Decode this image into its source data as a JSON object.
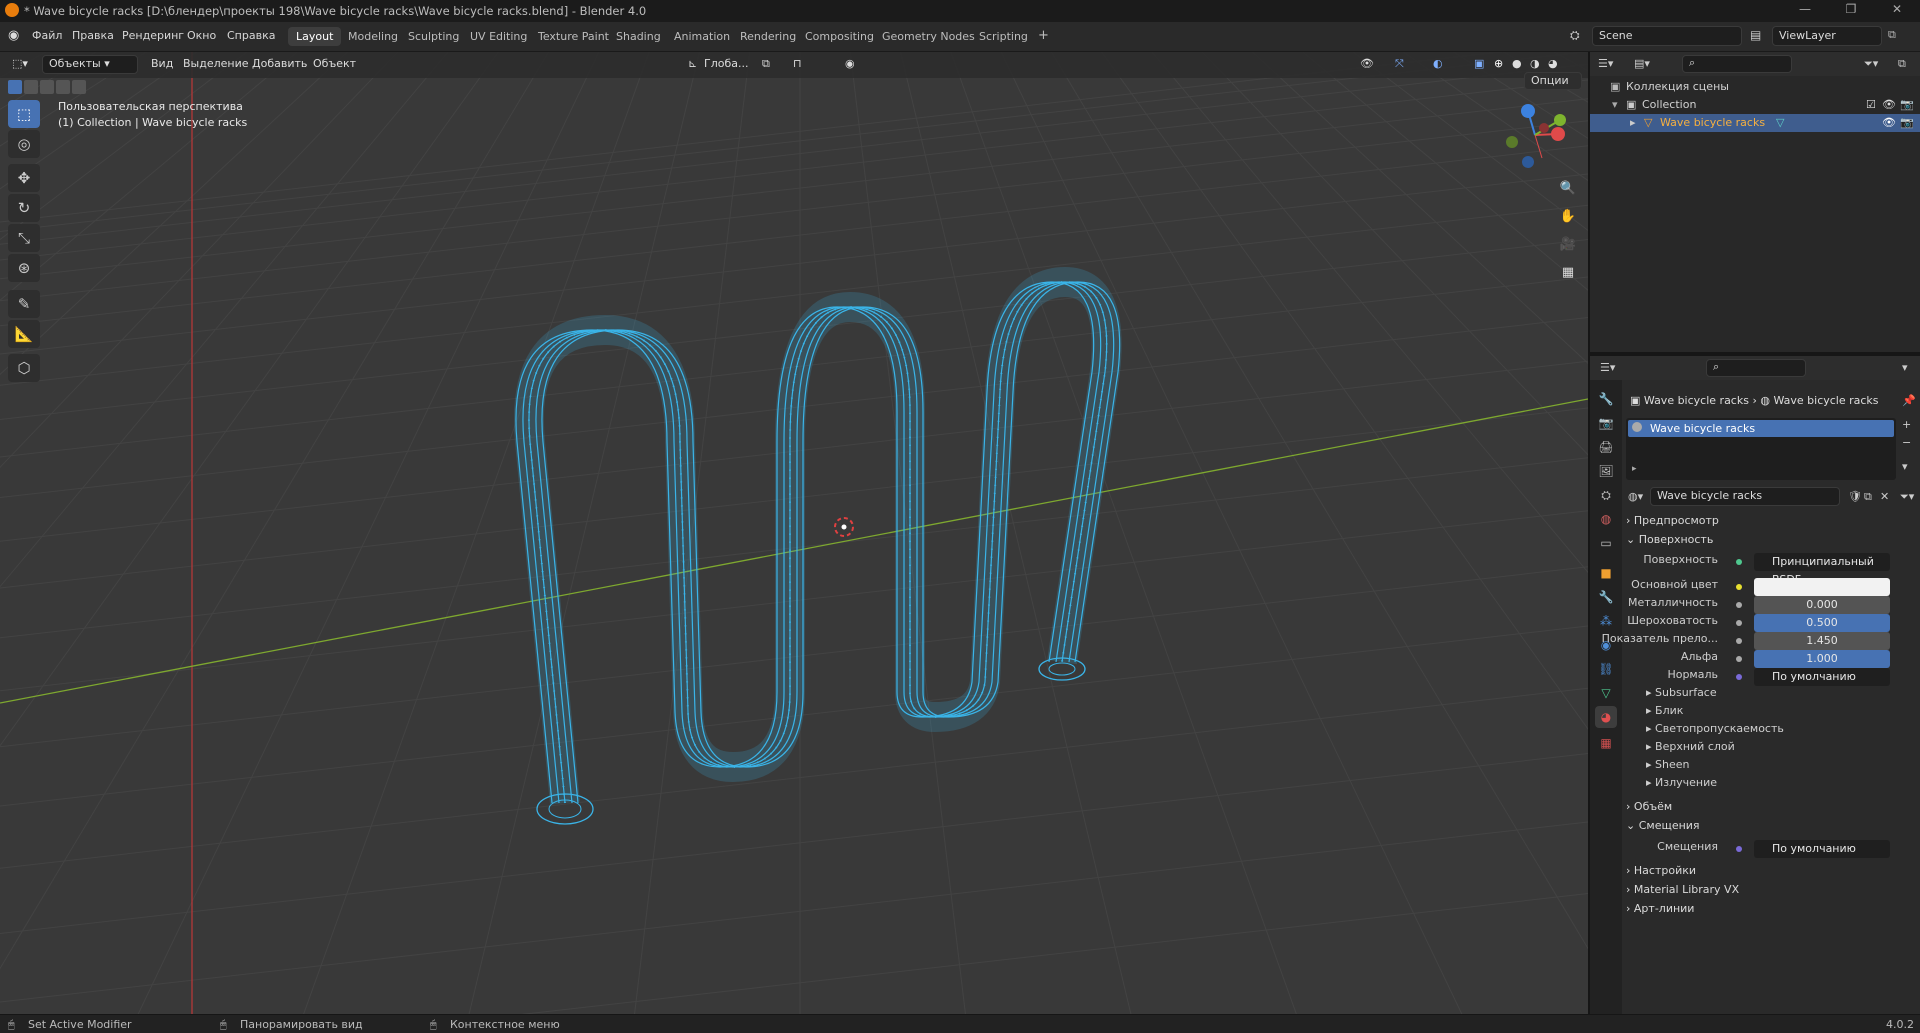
{
  "window": {
    "title": "* Wave bicycle racks [D:\\блендер\\проекты 198\\Wave bicycle racks\\Wave bicycle racks.blend] - Blender 4.0"
  },
  "menu": [
    "Файл",
    "Правка",
    "Рендеринг",
    "Окно",
    "Справка"
  ],
  "workspaces": [
    "Layout",
    "Modeling",
    "Sculpting",
    "UV Editing",
    "Texture Paint",
    "Shading",
    "Animation",
    "Rendering",
    "Compositing",
    "Geometry Nodes",
    "Scripting"
  ],
  "active_workspace": "Layout",
  "scene": {
    "name": "Scene",
    "view_layer": "ViewLayer"
  },
  "viewport": {
    "mode": "Объекты",
    "menu": [
      "Вид",
      "Выделение",
      "Добавить",
      "Объект"
    ],
    "transform_orientation": "Глоба...",
    "options": "Опции",
    "overlay_line1": "Пользовательская перспектива",
    "overlay_line2": "(1) Collection | Wave bicycle racks",
    "wire_color": "#3ab4e8",
    "grid_color": "#434343",
    "x_axis_color": "#c23a3a",
    "y_axis_color": "#7ea82f"
  },
  "outliner": {
    "root": "Коллекция сцены",
    "collection": "Collection",
    "object": "Wave bicycle racks"
  },
  "properties": {
    "breadcrumb_object": "Wave bicycle racks",
    "breadcrumb_material": "Wave bicycle racks",
    "slot": "Wave bicycle racks",
    "material_name": "Wave bicycle racks",
    "panel_preview": "Предпросмотр",
    "panel_surface": "Поверхность",
    "surface_label": "Поверхность",
    "surface_value": "Принципиальный BSDF",
    "base_color_label": "Основной цвет",
    "metallic_label": "Металличность",
    "metallic_value": "0.000",
    "roughness_label": "Шероховатость",
    "roughness_value": "0.500",
    "ior_label": "Показатель прело...",
    "ior_value": "1.450",
    "alpha_label": "Альфа",
    "alpha_value": "1.000",
    "normal_label": "Нормаль",
    "normal_value": "По умолчанию",
    "subpanels": [
      "Subsurface",
      "Блик",
      "Светопропускаемость",
      "Верхний слой",
      "Sheen",
      "Излучение"
    ],
    "panel_volume": "Объём",
    "panel_displacement": "Смещения",
    "displacement_label": "Смещения",
    "displacement_value": "По умолчанию",
    "panel_settings": "Настройки",
    "panel_library": "Material Library VX",
    "panel_lineart": "Арт-линии"
  },
  "status": {
    "left": "Set Active Modifier",
    "middle": "Панорамировать вид",
    "right": "Контекстное меню",
    "version": "4.0.2"
  }
}
